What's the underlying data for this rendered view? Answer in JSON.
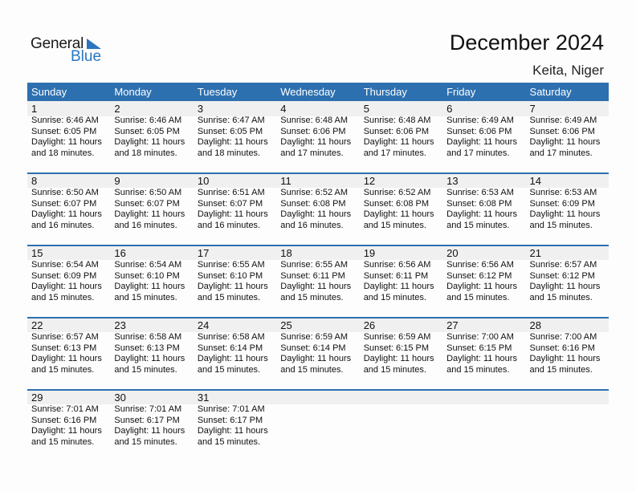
{
  "logo": {
    "word1": "General",
    "word2": "Blue",
    "accent": "#2a76c1"
  },
  "header": {
    "title": "December 2024",
    "location": "Keita, Niger"
  },
  "colors": {
    "header_bg": "#2d70b0",
    "number_band": "#f0f0f0"
  },
  "weekdays": [
    "Sunday",
    "Monday",
    "Tuesday",
    "Wednesday",
    "Thursday",
    "Friday",
    "Saturday"
  ],
  "weeks": [
    [
      {
        "day": "1",
        "sunrise": "Sunrise: 6:46 AM",
        "sunset": "Sunset: 6:05 PM",
        "daylight1": "Daylight: 11 hours",
        "daylight2": "and 18 minutes."
      },
      {
        "day": "2",
        "sunrise": "Sunrise: 6:46 AM",
        "sunset": "Sunset: 6:05 PM",
        "daylight1": "Daylight: 11 hours",
        "daylight2": "and 18 minutes."
      },
      {
        "day": "3",
        "sunrise": "Sunrise: 6:47 AM",
        "sunset": "Sunset: 6:05 PM",
        "daylight1": "Daylight: 11 hours",
        "daylight2": "and 18 minutes."
      },
      {
        "day": "4",
        "sunrise": "Sunrise: 6:48 AM",
        "sunset": "Sunset: 6:06 PM",
        "daylight1": "Daylight: 11 hours",
        "daylight2": "and 17 minutes."
      },
      {
        "day": "5",
        "sunrise": "Sunrise: 6:48 AM",
        "sunset": "Sunset: 6:06 PM",
        "daylight1": "Daylight: 11 hours",
        "daylight2": "and 17 minutes."
      },
      {
        "day": "6",
        "sunrise": "Sunrise: 6:49 AM",
        "sunset": "Sunset: 6:06 PM",
        "daylight1": "Daylight: 11 hours",
        "daylight2": "and 17 minutes."
      },
      {
        "day": "7",
        "sunrise": "Sunrise: 6:49 AM",
        "sunset": "Sunset: 6:06 PM",
        "daylight1": "Daylight: 11 hours",
        "daylight2": "and 17 minutes."
      }
    ],
    [
      {
        "day": "8",
        "sunrise": "Sunrise: 6:50 AM",
        "sunset": "Sunset: 6:07 PM",
        "daylight1": "Daylight: 11 hours",
        "daylight2": "and 16 minutes."
      },
      {
        "day": "9",
        "sunrise": "Sunrise: 6:50 AM",
        "sunset": "Sunset: 6:07 PM",
        "daylight1": "Daylight: 11 hours",
        "daylight2": "and 16 minutes."
      },
      {
        "day": "10",
        "sunrise": "Sunrise: 6:51 AM",
        "sunset": "Sunset: 6:07 PM",
        "daylight1": "Daylight: 11 hours",
        "daylight2": "and 16 minutes."
      },
      {
        "day": "11",
        "sunrise": "Sunrise: 6:52 AM",
        "sunset": "Sunset: 6:08 PM",
        "daylight1": "Daylight: 11 hours",
        "daylight2": "and 16 minutes."
      },
      {
        "day": "12",
        "sunrise": "Sunrise: 6:52 AM",
        "sunset": "Sunset: 6:08 PM",
        "daylight1": "Daylight: 11 hours",
        "daylight2": "and 15 minutes."
      },
      {
        "day": "13",
        "sunrise": "Sunrise: 6:53 AM",
        "sunset": "Sunset: 6:08 PM",
        "daylight1": "Daylight: 11 hours",
        "daylight2": "and 15 minutes."
      },
      {
        "day": "14",
        "sunrise": "Sunrise: 6:53 AM",
        "sunset": "Sunset: 6:09 PM",
        "daylight1": "Daylight: 11 hours",
        "daylight2": "and 15 minutes."
      }
    ],
    [
      {
        "day": "15",
        "sunrise": "Sunrise: 6:54 AM",
        "sunset": "Sunset: 6:09 PM",
        "daylight1": "Daylight: 11 hours",
        "daylight2": "and 15 minutes."
      },
      {
        "day": "16",
        "sunrise": "Sunrise: 6:54 AM",
        "sunset": "Sunset: 6:10 PM",
        "daylight1": "Daylight: 11 hours",
        "daylight2": "and 15 minutes."
      },
      {
        "day": "17",
        "sunrise": "Sunrise: 6:55 AM",
        "sunset": "Sunset: 6:10 PM",
        "daylight1": "Daylight: 11 hours",
        "daylight2": "and 15 minutes."
      },
      {
        "day": "18",
        "sunrise": "Sunrise: 6:55 AM",
        "sunset": "Sunset: 6:11 PM",
        "daylight1": "Daylight: 11 hours",
        "daylight2": "and 15 minutes."
      },
      {
        "day": "19",
        "sunrise": "Sunrise: 6:56 AM",
        "sunset": "Sunset: 6:11 PM",
        "daylight1": "Daylight: 11 hours",
        "daylight2": "and 15 minutes."
      },
      {
        "day": "20",
        "sunrise": "Sunrise: 6:56 AM",
        "sunset": "Sunset: 6:12 PM",
        "daylight1": "Daylight: 11 hours",
        "daylight2": "and 15 minutes."
      },
      {
        "day": "21",
        "sunrise": "Sunrise: 6:57 AM",
        "sunset": "Sunset: 6:12 PM",
        "daylight1": "Daylight: 11 hours",
        "daylight2": "and 15 minutes."
      }
    ],
    [
      {
        "day": "22",
        "sunrise": "Sunrise: 6:57 AM",
        "sunset": "Sunset: 6:13 PM",
        "daylight1": "Daylight: 11 hours",
        "daylight2": "and 15 minutes."
      },
      {
        "day": "23",
        "sunrise": "Sunrise: 6:58 AM",
        "sunset": "Sunset: 6:13 PM",
        "daylight1": "Daylight: 11 hours",
        "daylight2": "and 15 minutes."
      },
      {
        "day": "24",
        "sunrise": "Sunrise: 6:58 AM",
        "sunset": "Sunset: 6:14 PM",
        "daylight1": "Daylight: 11 hours",
        "daylight2": "and 15 minutes."
      },
      {
        "day": "25",
        "sunrise": "Sunrise: 6:59 AM",
        "sunset": "Sunset: 6:14 PM",
        "daylight1": "Daylight: 11 hours",
        "daylight2": "and 15 minutes."
      },
      {
        "day": "26",
        "sunrise": "Sunrise: 6:59 AM",
        "sunset": "Sunset: 6:15 PM",
        "daylight1": "Daylight: 11 hours",
        "daylight2": "and 15 minutes."
      },
      {
        "day": "27",
        "sunrise": "Sunrise: 7:00 AM",
        "sunset": "Sunset: 6:15 PM",
        "daylight1": "Daylight: 11 hours",
        "daylight2": "and 15 minutes."
      },
      {
        "day": "28",
        "sunrise": "Sunrise: 7:00 AM",
        "sunset": "Sunset: 6:16 PM",
        "daylight1": "Daylight: 11 hours",
        "daylight2": "and 15 minutes."
      }
    ],
    [
      {
        "day": "29",
        "sunrise": "Sunrise: 7:01 AM",
        "sunset": "Sunset: 6:16 PM",
        "daylight1": "Daylight: 11 hours",
        "daylight2": "and 15 minutes."
      },
      {
        "day": "30",
        "sunrise": "Sunrise: 7:01 AM",
        "sunset": "Sunset: 6:17 PM",
        "daylight1": "Daylight: 11 hours",
        "daylight2": "and 15 minutes."
      },
      {
        "day": "31",
        "sunrise": "Sunrise: 7:01 AM",
        "sunset": "Sunset: 6:17 PM",
        "daylight1": "Daylight: 11 hours",
        "daylight2": "and 15 minutes."
      },
      null,
      null,
      null,
      null
    ]
  ]
}
